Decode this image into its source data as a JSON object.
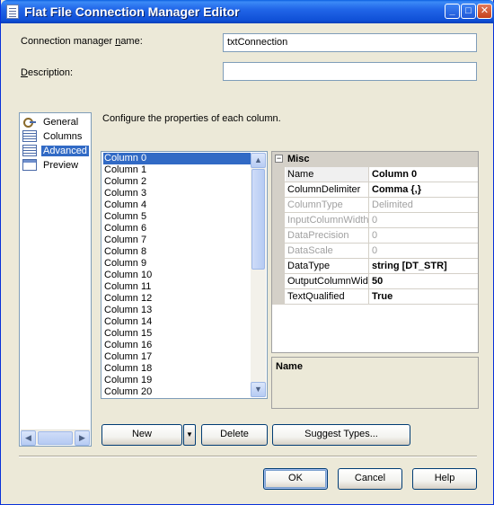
{
  "window": {
    "title": "Flat File Connection Manager Editor",
    "buttons": {
      "minimize": "_",
      "maximize": "□",
      "close": "✕"
    }
  },
  "form": {
    "name_label": "Connection manager name:",
    "name_value": "txtConnection",
    "description_label": "Description:",
    "description_value": ""
  },
  "nav": {
    "items": [
      {
        "label": "General",
        "icon": "general-icon"
      },
      {
        "label": "Columns",
        "icon": "columns-icon"
      },
      {
        "label": "Advanced",
        "icon": "advanced-icon"
      },
      {
        "label": "Preview",
        "icon": "preview-icon"
      }
    ],
    "selected": "Advanced"
  },
  "main": {
    "instruction": "Configure the properties of each column."
  },
  "columns_list": {
    "items": [
      "Column 0",
      "Column 1",
      "Column 2",
      "Column 3",
      "Column 4",
      "Column 5",
      "Column 6",
      "Column 7",
      "Column 8",
      "Column 9",
      "Column 10",
      "Column 11",
      "Column 12",
      "Column 13",
      "Column 14",
      "Column 15",
      "Column 16",
      "Column 17",
      "Column 18",
      "Column 19",
      "Column 20"
    ],
    "selected": "Column 0"
  },
  "property_grid": {
    "category": "Misc",
    "rows": [
      {
        "name": "Name",
        "value": "Column 0"
      },
      {
        "name": "ColumnDelimiter",
        "value": "Comma {,}"
      },
      {
        "name": "ColumnType",
        "value": "Delimited"
      },
      {
        "name": "InputColumnWidth",
        "value": "0"
      },
      {
        "name": "DataPrecision",
        "value": "0"
      },
      {
        "name": "DataScale",
        "value": "0"
      },
      {
        "name": "DataType",
        "value": "string [DT_STR]"
      },
      {
        "name": "OutputColumnWid",
        "value": "50"
      },
      {
        "name": "TextQualified",
        "value": "True"
      }
    ]
  },
  "description_panel": {
    "title": "Name"
  },
  "buttons": {
    "new": "New",
    "delete": "Delete",
    "suggest_types": "Suggest Types...",
    "ok": "OK",
    "cancel": "Cancel",
    "help": "Help"
  }
}
